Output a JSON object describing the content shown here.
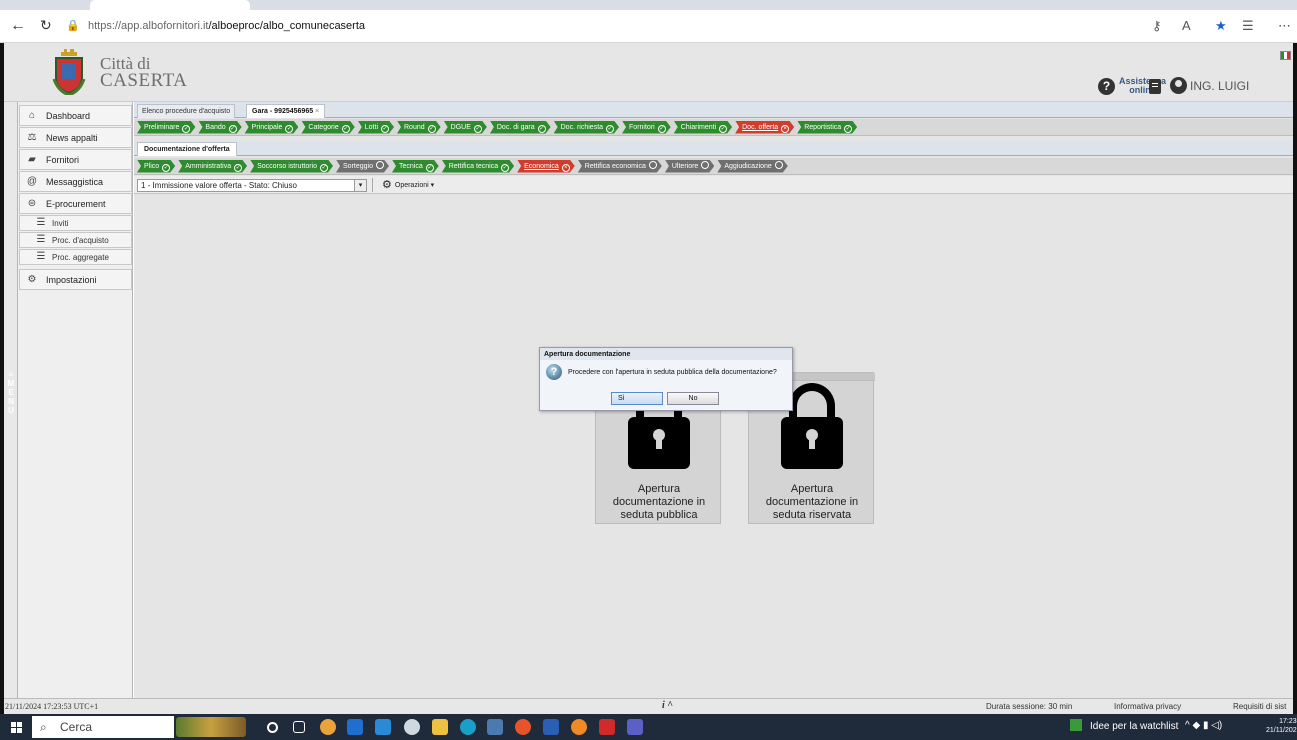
{
  "browser": {
    "url_host": "https://app.albofornitori.it",
    "url_path": "/alboeproc/albo_comunecaserta"
  },
  "header": {
    "city_line1": "Città di",
    "city_line2": "CASERTA",
    "assist_line1": "Assistenza",
    "assist_line2": "online",
    "user_name": "ING. LUIGI"
  },
  "sidebar": {
    "menu_label": "MENU",
    "items": [
      {
        "label": "Dashboard",
        "icon": "home-icon"
      },
      {
        "label": "News appalti",
        "icon": "scales-icon"
      },
      {
        "label": "Fornitori",
        "icon": "truck-icon"
      },
      {
        "label": "Messaggistica",
        "icon": "at-icon"
      },
      {
        "label": "E-procurement",
        "icon": "coins-icon"
      }
    ],
    "subitems": [
      {
        "label": "Inviti"
      },
      {
        "label": "Proc. d'acquisto"
      },
      {
        "label": "Proc. aggregate"
      }
    ],
    "settings": {
      "label": "Impostazioni",
      "icon": "gear-icon"
    }
  },
  "tabs": {
    "tab1": "Elenco procedure d'acquisto",
    "tab2": "Gara - 9925456965",
    "tab2_close": "×"
  },
  "steps1": [
    {
      "label": "Preliminare",
      "state": "ok"
    },
    {
      "label": "Bando",
      "state": "ok"
    },
    {
      "label": "Principale",
      "state": "ok"
    },
    {
      "label": "Categorie",
      "state": "ok"
    },
    {
      "label": "Lotti",
      "state": "ok"
    },
    {
      "label": "Round",
      "state": "ok"
    },
    {
      "label": "DGUE",
      "state": "ok"
    },
    {
      "label": "Doc. di gara",
      "state": "ok"
    },
    {
      "label": "Doc. richiesta",
      "state": "ok"
    },
    {
      "label": "Fornitori",
      "state": "ok"
    },
    {
      "label": "Chiarimenti",
      "state": "ok"
    },
    {
      "label": "Doc. offerta",
      "state": "error"
    },
    {
      "label": "Reportistica",
      "state": "ok"
    }
  ],
  "subheader": "Documentazione d'offerta",
  "steps2": [
    {
      "label": "Plico",
      "state": "ok"
    },
    {
      "label": "Amministrativa",
      "state": "ok"
    },
    {
      "label": "Soccorso istruttorio",
      "state": "ok"
    },
    {
      "label": "Sorteggio",
      "state": "pending"
    },
    {
      "label": "Tecnica",
      "state": "ok"
    },
    {
      "label": "Rettifica tecnica",
      "state": "ok"
    },
    {
      "label": "Economica",
      "state": "error"
    },
    {
      "label": "Rettifica economica",
      "state": "pending"
    },
    {
      "label": "Ulteriore",
      "state": "pending"
    },
    {
      "label": "Aggiudicazione",
      "state": "pending"
    }
  ],
  "toolbar": {
    "select_value": "1 - Immissione valore offerta - Stato: Chiuso",
    "operations_label": "Operazioni ▾"
  },
  "panels": [
    {
      "line1": "Apertura",
      "line2": "documentazione in",
      "line3": "seduta pubblica"
    },
    {
      "line1": "Apertura",
      "line2": "documentazione in",
      "line3": "seduta riservata"
    }
  ],
  "dialog": {
    "title": "Apertura documentazione",
    "message": "Procedere con l'apertura in seduta pubblica della documentazione?",
    "yes_label": "Sì",
    "no_label": "No"
  },
  "status": {
    "timestamp": "21/11/2024 17:23:53 UTC+1",
    "info": "i ^",
    "session": "Durata sessione: 30 min",
    "privacy": "Informativa privacy",
    "requirements": "Requisiti di sist"
  },
  "taskbar": {
    "search_label": "Cerca",
    "watchlist": "Idee per la watchlist",
    "time": "17:23",
    "date": "21/11/202"
  },
  "colors": {
    "step_ok": "#2e8b2e",
    "step_error": "#d23c2a",
    "step_pending": "#6f6f6f"
  }
}
